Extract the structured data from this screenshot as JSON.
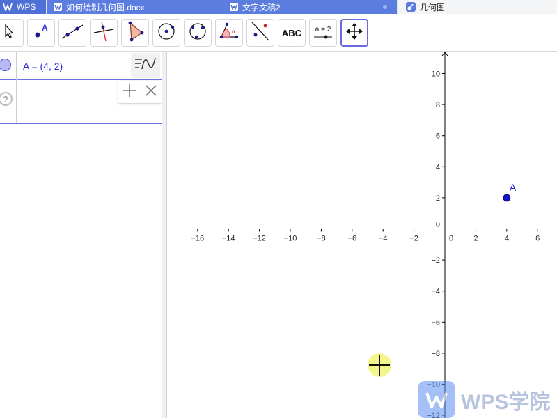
{
  "tabs": [
    {
      "label": "WPS"
    },
    {
      "label": "如何绘制几何图.docx"
    },
    {
      "label": "文字文稿2"
    },
    {
      "label": "几何图"
    }
  ],
  "toolbar": {
    "text_tool_label": "ABC",
    "slider_tool_label": "a = 2"
  },
  "algebra": {
    "point_entry": "A = (4, 2)",
    "help_symbol": "?"
  },
  "graphics": {
    "point_label": "A",
    "point": {
      "x": 4,
      "y": 2
    },
    "x_ticks": [
      "−16",
      "−14",
      "−12",
      "−10",
      "−8",
      "−6",
      "−4",
      "−2",
      "0",
      "2",
      "4",
      "6"
    ],
    "y_ticks": [
      "10",
      "8",
      "6",
      "4",
      "2",
      "0",
      "−2",
      "−4",
      "−6",
      "−8",
      "−10",
      "−12"
    ],
    "x_tick_values": [
      -16,
      -14,
      -12,
      -10,
      -8,
      -6,
      -4,
      -2,
      0,
      2,
      4,
      6
    ],
    "y_tick_values": [
      10,
      8,
      6,
      4,
      2,
      0,
      -2,
      -4,
      -6,
      -8,
      -10,
      -12
    ],
    "axis_color": "#000000",
    "point_color": "#1414d2"
  },
  "watermark": {
    "text": "WPS学院"
  },
  "colors": {
    "accent": "#5b7de0",
    "algebra_text": "#2c2cd8"
  }
}
